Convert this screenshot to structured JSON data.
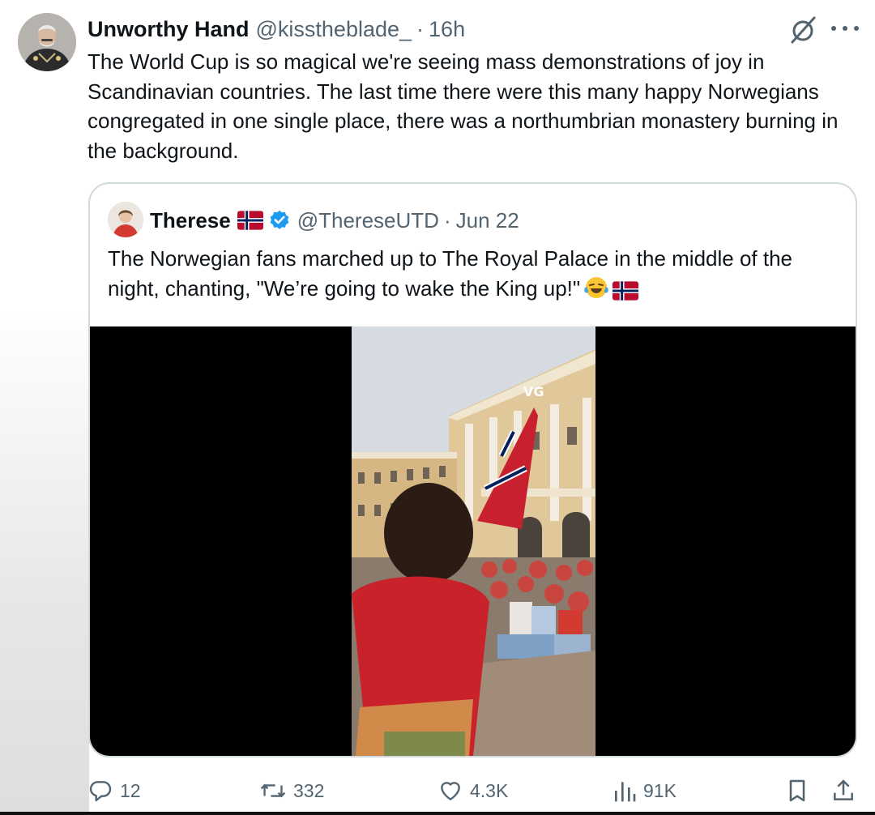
{
  "tweet": {
    "author_name": "Unworthy Hand",
    "author_handle": "@kisstheblade_",
    "separator": "·",
    "time": "16h",
    "text": "The World Cup is so magical we're seeing mass demonstrations of joy in Scandinavian countries. The last time there were this many happy Norwegians congregated in one single place, there was a northumbrian monastery burning in the background.",
    "icons": [
      "grok-icon",
      "more-icon"
    ]
  },
  "quote": {
    "author_name": "Therese",
    "author_handle": "@ThereseUTD",
    "separator": "·",
    "date": "Jun 22",
    "text": "The Norwegian fans marched up to The Royal Palace in the middle of the night, chanting, \"We’re going to wake the King up!\"",
    "emojis": [
      "laughing-crying-emoji",
      "norway-flag-emoji"
    ],
    "video_watermark": "VG"
  },
  "actions": {
    "replies": "12",
    "reposts": "332",
    "likes": "4.3K",
    "views": "91K"
  },
  "colors": {
    "text": "#0f1419",
    "secondary": "#536471",
    "border": "#cfd9de",
    "verified": "#1d9bf0",
    "norway_red": "#ba0c2f",
    "norway_blue": "#00205b"
  }
}
